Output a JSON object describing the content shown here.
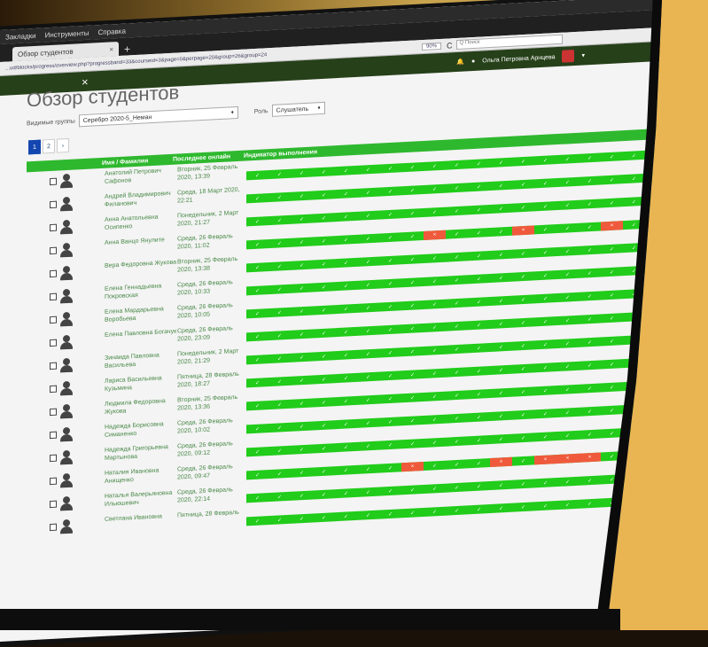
{
  "browser": {
    "menu": [
      "Закладки",
      "Инструменты",
      "Справка"
    ],
    "tab_title": "Обзор студентов",
    "tab_close": "×",
    "new_tab": "+",
    "url": "...ud/blocks/progress/overview.php?progressbarid=33&courseid=3&page=0&perpage=20&group=26&group=24",
    "zoom": "90%",
    "reload": "C",
    "search_placeholder": "Q Поиск"
  },
  "topbar": {
    "close": "×",
    "user_name": "Ольга Петровна Арнцева",
    "bell_icon": "bell-icon",
    "chat_icon": "chat-icon"
  },
  "page": {
    "title": "Обзор студентов",
    "groups_label": "Видимые группы",
    "group_value": "Серебро 2020-5_Неман",
    "role_label": "Роль",
    "role_value": "Слушатель",
    "pages": [
      "1",
      "2",
      "›"
    ],
    "col_name": "Имя / Фамилия",
    "col_last": "Последнее онлайн",
    "col_progress": "Индикатор выполнения"
  },
  "check_symbol": "✓",
  "fail_symbol": "×",
  "colors": {
    "complete": "#21cc1a",
    "fail": "#f05a3c",
    "header": "#2eb82e",
    "topbar": "#26401a"
  },
  "students": [
    {
      "name": "Анатолий Петрович Сафонов",
      "last": "Вторник, 25 Февраль 2020, 13:39",
      "fails": []
    },
    {
      "name": "Андрей Владимирович Филанович",
      "last": "Среда, 18 Март 2020, 22:21",
      "fails": []
    },
    {
      "name": "Анна Анатольевна Осипенко",
      "last": "Понедельник, 2 Март 2020, 21:27",
      "fails": []
    },
    {
      "name": "Анна Ванцо Янулите",
      "last": "Среда, 26 Февраль 2020, 11:02",
      "fails": [
        8,
        12,
        16,
        18,
        19
      ]
    },
    {
      "name": "Вера Федоровна Жукова",
      "last": "Вторник, 25 Февраль 2020, 13:38",
      "fails": []
    },
    {
      "name": "Елена Геннадьевна Покровская",
      "last": "Среда, 26 Февраль 2020, 10:33",
      "fails": []
    },
    {
      "name": "Елена Мардарьевна Воробьева",
      "last": "Среда, 26 Февраль 2020, 10:05",
      "fails": [
        19
      ]
    },
    {
      "name": "Елена Павловна Богачук",
      "last": "Среда, 26 Февраль 2020, 23:09",
      "fails": []
    },
    {
      "name": "Зинаида Павловна Васильева",
      "last": "Понедельник, 2 Март 2020, 21:29",
      "fails": []
    },
    {
      "name": "Лариса Васильевна Кузьмина",
      "last": "Пятница, 28 Февраль 2020, 18:27",
      "fails": []
    },
    {
      "name": "Людмила Федоровна Жукова",
      "last": "Вторник, 25 Февраль 2020, 13:36",
      "fails": []
    },
    {
      "name": "Надежда Борисовна Симаненко",
      "last": "Среда, 26 Февраль 2020, 10:02",
      "fails": []
    },
    {
      "name": "Надежда Григорьевна Мартынова",
      "last": "Среда, 26 Февраль 2020, 09:12",
      "fails": []
    },
    {
      "name": "Наталия Ивановна Анищенко",
      "last": "Среда, 26 Февраль 2020, 09:47",
      "fails": [
        7,
        11,
        13,
        14,
        15,
        17,
        18
      ]
    },
    {
      "name": "Наталья Валерьяновна Ильюшевич",
      "last": "Среда, 26 Февраль 2020, 22:14",
      "fails": []
    },
    {
      "name": "Светлана Ивановна",
      "last": "Пятница, 28 Февраль",
      "fails": []
    }
  ]
}
